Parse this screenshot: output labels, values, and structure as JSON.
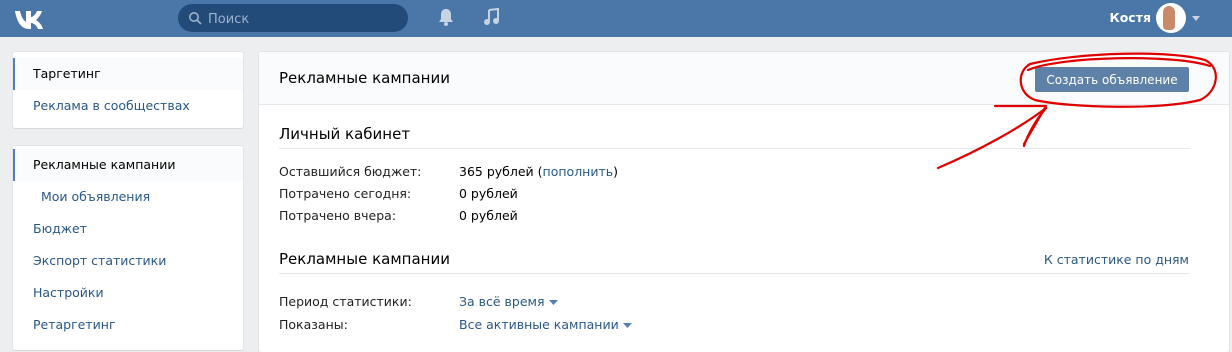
{
  "header": {
    "logo_icon": "vk-logo-icon",
    "search_placeholder": "Поиск",
    "notifications_icon": "bell-icon",
    "music_icon": "music-note-icon",
    "username": "Костя",
    "brand_color": "#4a76a8"
  },
  "sidebar_top": {
    "items": [
      {
        "label": "Таргетинг",
        "active": true
      },
      {
        "label": "Реклама в сообществах",
        "active": false
      }
    ]
  },
  "sidebar_bottom": {
    "items": [
      {
        "label": "Рекламные кампании",
        "active": true
      },
      {
        "label": "Мои объявления",
        "active": false
      },
      {
        "label": "Бюджет",
        "active": false
      },
      {
        "label": "Экспорт статистики",
        "active": false
      },
      {
        "label": "Настройки",
        "active": false
      },
      {
        "label": "Ретаргетинг",
        "active": false
      }
    ]
  },
  "main": {
    "title": "Рекламные кампании",
    "create_button": "Создать объявление",
    "account": {
      "title": "Личный кабинет",
      "rows": [
        {
          "label": "Оставшийся бюджет:",
          "value": "365 рублей",
          "paren_open": " (",
          "link": "пополнить",
          "paren_close": ")"
        },
        {
          "label": "Потрачено сегодня:",
          "value": "0 рублей"
        },
        {
          "label": "Потрачено вчера:",
          "value": "0 рублей"
        }
      ]
    },
    "campaigns": {
      "title": "Рекламные кампании",
      "stats_link": "К статистике по дням",
      "period_label": "Период статистики:",
      "period_value": "За всё время",
      "shown_label": "Показаны:",
      "shown_value": "Все активные кампании"
    }
  },
  "annotation_color": "#e00000"
}
